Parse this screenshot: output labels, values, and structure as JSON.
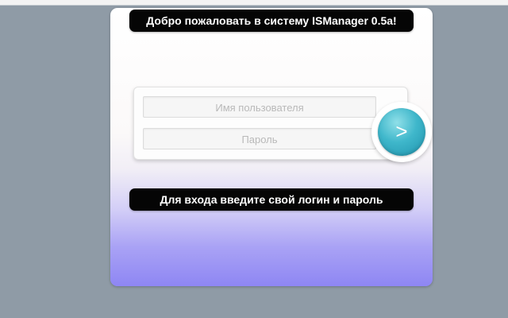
{
  "login_panel": {
    "welcome_text": "Добро пожаловать в систему ISManager 0.5a!",
    "username_placeholder": "Имя пользователя",
    "password_placeholder": "Пароль",
    "submit_label": ">",
    "hint_text": "Для входа введите свой логин и пароль"
  },
  "colors": {
    "page_background": "#8f9ba6",
    "pill_background": "#050505",
    "button_accent": "#3fb7cb",
    "gradient_bottom": "#8e86f3"
  },
  "icons": {
    "submit": "arrow-right-icon"
  }
}
